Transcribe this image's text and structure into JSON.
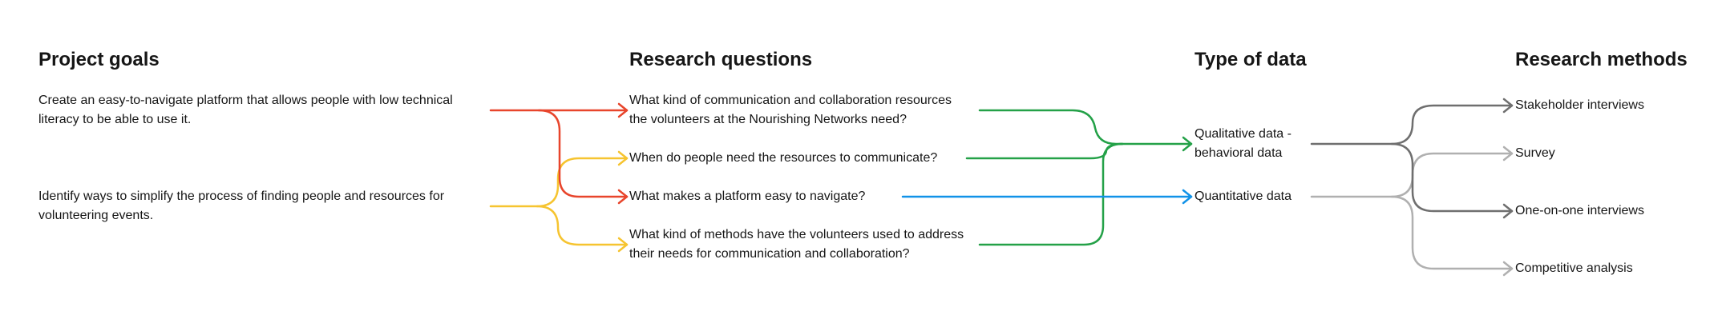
{
  "colors": {
    "goal1": "#e8452c",
    "goal2": "#f6c430",
    "qualitative": "#24a148",
    "quantitative": "#1192e8",
    "method_dark": "#6f6f6f",
    "method_light": "#b0b0b0"
  },
  "columns": {
    "goals": {
      "title": "Project goals"
    },
    "questions": {
      "title": "Research questions"
    },
    "data": {
      "title": "Type of data"
    },
    "methods": {
      "title": "Research methods"
    }
  },
  "goals": [
    {
      "text": "Create an easy-to-navigate platform that allows people with low technical literacy to be able to use it."
    },
    {
      "text": "Identify ways to simplify the process of finding people and resources for volunteering events."
    }
  ],
  "questions": [
    {
      "text": "What kind of communication and collaboration resources the volunteers at the Nourishing Networks need?"
    },
    {
      "text": "When do people need the resources to communicate?"
    },
    {
      "text": "What makes a platform easy to navigate?"
    },
    {
      "text": "What kind of methods have the volunteers used to address their needs for communication and collaboration?"
    }
  ],
  "data_types": [
    {
      "text": "Qualitative data - behavioral data"
    },
    {
      "text": "Quantitative data"
    }
  ],
  "methods": [
    {
      "text": "Stakeholder interviews"
    },
    {
      "text": "Survey"
    },
    {
      "text": "One-on-one interviews"
    },
    {
      "text": "Competitive analysis"
    }
  ]
}
